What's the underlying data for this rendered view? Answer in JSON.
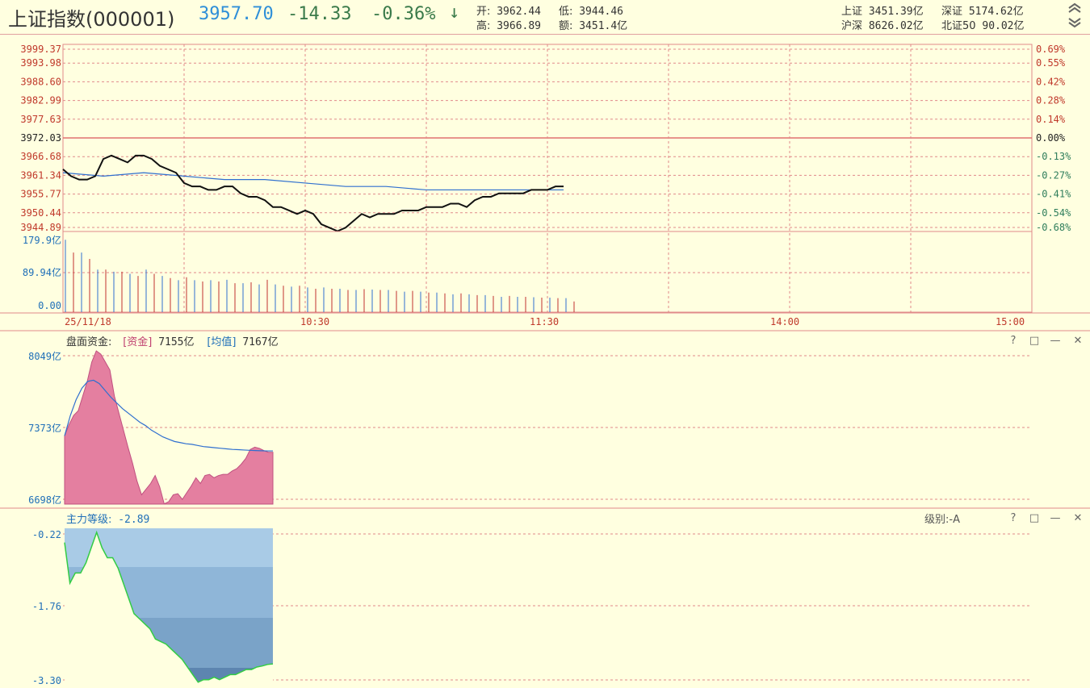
{
  "header": {
    "title": "上证指数(000001)",
    "price": "3957.70",
    "change": "-14.33",
    "change_pct": "-0.36%",
    "arrow": "↓",
    "open_label": "开:",
    "open": "3962.44",
    "low_label": "低:",
    "low": "3944.46",
    "high_label": "高:",
    "high": "3966.89",
    "amount_label": "额:",
    "amount": "3451.4亿",
    "sh_label": "上证",
    "sh": "3451.39亿",
    "sz_label": "深证",
    "sz": "5174.62亿",
    "hs_label": "沪深",
    "hs": "8626.02亿",
    "bz_label": "北证50",
    "bz": "90.02亿"
  },
  "colors": {
    "background": "#ffffe0",
    "grid": "#e08a8a",
    "price_line": "#111111",
    "avg_line": "#2f6fcf",
    "fund_fill": "#e47fa0",
    "level_fill": "#7fa8cc",
    "level_line": "#33cc44",
    "zero_line": "#e07070",
    "up_text": "#c0392b",
    "down_text": "#2e7d5b",
    "axis_blue": "#1f6fb8"
  },
  "chart_data": [
    {
      "type": "line",
      "title": "",
      "y_ticks_left": [
        "3999.37",
        "3993.98",
        "3988.60",
        "3982.99",
        "3977.63",
        "3972.03",
        "3966.68",
        "3961.34",
        "3955.77",
        "3950.44",
        "3944.89"
      ],
      "y_ticks_right": [
        "0.69%",
        "0.55%",
        "0.42%",
        "0.28%",
        "0.14%",
        "0.00%",
        "-0.13%",
        "-0.27%",
        "-0.41%",
        "-0.54%",
        "-0.68%"
      ],
      "ylim": [
        3944.89,
        3999.37
      ],
      "prev_close": 3972.03,
      "time_labels": [
        "25/11/18",
        "10:30",
        "11:30",
        "14:00",
        "15:00"
      ],
      "total_minutes": 240,
      "price_series": [
        [
          0,
          3963
        ],
        [
          2,
          3961
        ],
        [
          4,
          3960
        ],
        [
          6,
          3960
        ],
        [
          8,
          3961
        ],
        [
          10,
          3966
        ],
        [
          12,
          3967
        ],
        [
          14,
          3966
        ],
        [
          16,
          3965
        ],
        [
          18,
          3967
        ],
        [
          20,
          3967
        ],
        [
          22,
          3966
        ],
        [
          24,
          3964
        ],
        [
          26,
          3963
        ],
        [
          28,
          3962
        ],
        [
          30,
          3959
        ],
        [
          32,
          3958
        ],
        [
          34,
          3958
        ],
        [
          36,
          3957
        ],
        [
          38,
          3957
        ],
        [
          40,
          3958
        ],
        [
          42,
          3958
        ],
        [
          44,
          3956
        ],
        [
          46,
          3955
        ],
        [
          48,
          3955
        ],
        [
          50,
          3954
        ],
        [
          52,
          3952
        ],
        [
          54,
          3952
        ],
        [
          56,
          3951
        ],
        [
          58,
          3950
        ],
        [
          60,
          3951
        ],
        [
          62,
          3950
        ],
        [
          64,
          3947
        ],
        [
          66,
          3946
        ],
        [
          68,
          3945
        ],
        [
          70,
          3946
        ],
        [
          72,
          3948
        ],
        [
          74,
          3950
        ],
        [
          76,
          3949
        ],
        [
          78,
          3950
        ],
        [
          80,
          3950
        ],
        [
          82,
          3950
        ],
        [
          84,
          3951
        ],
        [
          86,
          3951
        ],
        [
          88,
          3951
        ],
        [
          90,
          3952
        ],
        [
          92,
          3952
        ],
        [
          94,
          3952
        ],
        [
          96,
          3953
        ],
        [
          98,
          3953
        ],
        [
          100,
          3952
        ],
        [
          102,
          3954
        ],
        [
          104,
          3955
        ],
        [
          106,
          3955
        ],
        [
          108,
          3956
        ],
        [
          110,
          3956
        ],
        [
          112,
          3956
        ],
        [
          114,
          3956
        ],
        [
          116,
          3957
        ],
        [
          118,
          3957
        ],
        [
          120,
          3957
        ],
        [
          122,
          3958
        ],
        [
          124,
          3958
        ]
      ],
      "avg_series": [
        [
          0,
          3962
        ],
        [
          10,
          3961
        ],
        [
          20,
          3962
        ],
        [
          30,
          3961
        ],
        [
          40,
          3960
        ],
        [
          50,
          3960
        ],
        [
          60,
          3959
        ],
        [
          70,
          3958
        ],
        [
          80,
          3958
        ],
        [
          90,
          3957
        ],
        [
          100,
          3957
        ],
        [
          110,
          3957
        ],
        [
          124,
          3957
        ]
      ]
    },
    {
      "type": "bar",
      "title": "",
      "y_ticks": [
        "179.9亿",
        "89.94亿",
        "0.00"
      ],
      "ylim": [
        0,
        179.9
      ],
      "values": [
        170,
        140,
        140,
        125,
        100,
        100,
        95,
        95,
        90,
        85,
        100,
        90,
        85,
        80,
        75,
        82,
        75,
        72,
        75,
        72,
        76,
        68,
        68,
        70,
        65,
        76,
        65,
        62,
        60,
        62,
        58,
        55,
        58,
        55,
        55,
        52,
        52,
        54,
        53,
        52,
        52,
        50,
        48,
        50,
        48,
        46,
        46,
        44,
        42,
        44,
        42,
        40,
        40,
        38,
        36,
        38,
        36,
        36,
        35,
        34,
        34,
        33,
        33,
        25
      ]
    },
    {
      "type": "area",
      "title": "盘面资金:",
      "legend": [
        {
          "name": "[资金]",
          "value": "7155亿"
        },
        {
          "name": "[均值]",
          "value": "7167亿"
        }
      ],
      "y_ticks": [
        "8049亿",
        "7373亿",
        "6698亿"
      ],
      "ylim": [
        6698,
        8049
      ],
      "fund_series": [
        7300,
        7400,
        7480,
        7520,
        7650,
        7780,
        7950,
        8049,
        8020,
        7950,
        7880,
        7650,
        7500,
        7350,
        7200,
        7060,
        6900,
        6780,
        6830,
        6880,
        6950,
        6850,
        6700,
        6720,
        6780,
        6790,
        6740,
        6800,
        6860,
        6930,
        6880,
        6950,
        6960,
        6930,
        6950,
        6960,
        6960,
        6990,
        7010,
        7050,
        7100,
        7180,
        7200,
        7190,
        7170,
        7155,
        7155
      ],
      "avg_series": [
        7300,
        7480,
        7620,
        7720,
        7780,
        7790,
        7760,
        7700,
        7640,
        7590,
        7540,
        7500,
        7460,
        7420,
        7390,
        7350,
        7320,
        7290,
        7270,
        7250,
        7240,
        7230,
        7225,
        7215,
        7205,
        7200,
        7195,
        7190,
        7185,
        7180,
        7178,
        7175,
        7172,
        7170,
        7168,
        7167,
        7167
      ]
    },
    {
      "type": "area",
      "title": "主力等级:",
      "title_value": "-2.89",
      "level_label": "级别:-A",
      "y_ticks": [
        "-0.22",
        "-1.76",
        "-3.30"
      ],
      "ylim": [
        -3.3,
        -0.22
      ],
      "level_series": [
        -0.5,
        -1.3,
        -1.1,
        -1.1,
        -0.9,
        -0.6,
        -0.3,
        -0.6,
        -0.8,
        -0.8,
        -1.0,
        -1.3,
        -1.6,
        -1.9,
        -2.0,
        -2.1,
        -2.2,
        -2.4,
        -2.45,
        -2.5,
        -2.6,
        -2.7,
        -2.8,
        -2.95,
        -3.1,
        -3.25,
        -3.2,
        -3.2,
        -3.15,
        -3.2,
        -3.15,
        -3.1,
        -3.1,
        -3.05,
        -3.0,
        -3.0,
        -2.95,
        -2.93,
        -2.9,
        -2.89
      ]
    }
  ]
}
